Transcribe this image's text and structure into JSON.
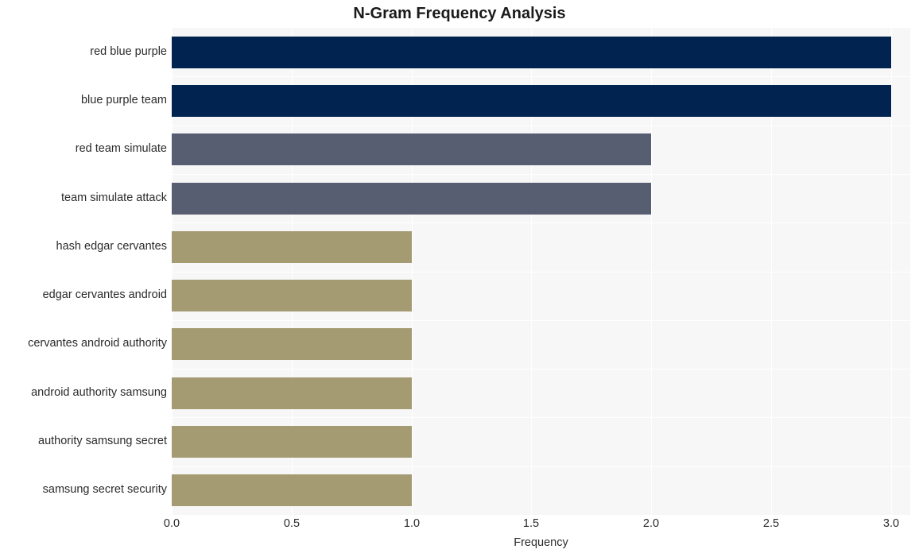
{
  "chart_data": {
    "type": "bar",
    "orientation": "horizontal",
    "title": "N-Gram Frequency Analysis",
    "xlabel": "Frequency",
    "ylabel": "",
    "categories": [
      "red blue purple",
      "blue purple team",
      "red team simulate",
      "team simulate attack",
      "hash edgar cervantes",
      "edgar cervantes android",
      "cervantes android authority",
      "android authority samsung",
      "authority samsung secret",
      "samsung secret security"
    ],
    "values": [
      3,
      3,
      2,
      2,
      1,
      1,
      1,
      1,
      1,
      1
    ],
    "bar_colors": [
      "#00244f",
      "#00244f",
      "#575e71",
      "#575e71",
      "#a49b72",
      "#a49b72",
      "#a49b72",
      "#a49b72",
      "#a49b72",
      "#a49b72"
    ],
    "xlim": [
      0,
      3.08
    ],
    "xticks": [
      0.0,
      0.5,
      1.0,
      1.5,
      2.0,
      2.5,
      3.0
    ],
    "xticklabels": [
      "0.0",
      "0.5",
      "1.0",
      "1.5",
      "2.0",
      "2.5",
      "3.0"
    ],
    "grid": true,
    "grid_color": "#ffffff",
    "plot_background": "#f7f7f7",
    "figure_background": "#ffffff",
    "legend": null
  }
}
